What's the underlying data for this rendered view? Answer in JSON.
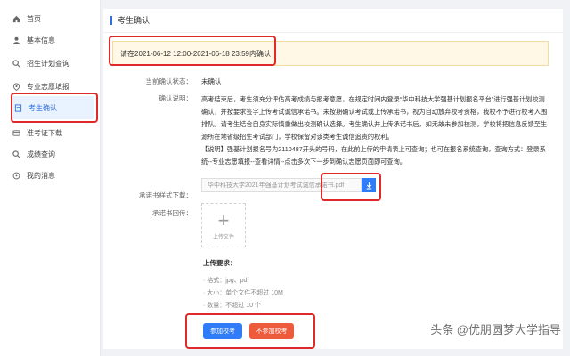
{
  "sidebar": {
    "items": [
      {
        "label": "首页",
        "icon": "home-icon"
      },
      {
        "label": "基本信息",
        "icon": "user-icon"
      },
      {
        "label": "招生计划查询",
        "icon": "search-icon"
      },
      {
        "label": "专业志愿填报",
        "icon": "location-icon"
      },
      {
        "label": "考生确认",
        "icon": "document-icon"
      },
      {
        "label": "准考证下载",
        "icon": "card-icon"
      },
      {
        "label": "成绩查询",
        "icon": "search-icon"
      },
      {
        "label": "我的消息",
        "icon": "message-icon"
      }
    ],
    "active_index": 4
  },
  "page": {
    "title": "考生确认",
    "notice": "请在2021-06-12 12:00-2021-06-18 23:59内确认",
    "status_label": "当前确认状态：",
    "status_value": "未确认",
    "desc_label": "确认说明：",
    "desc_paragraph1": "高考结束后，考生须充分评估高考成绩与报考意愿，在规定时间内登录“华中科技大学强基计划报名平台”进行强基计划校测确认，并按要求签字上传考试诚信承诺书。未按期确认考试或上传承诺书，视为自动放弃校考资格，我校不予进行校考入围排队。请考生结合自身实际慎重做出校测确认选择。考生确认并上传承诺书后，如无故未参加校测，学校将把信息反馈至生源所在地省级招生考试部门，学校保留对该类考生诚信追责的权利。",
    "desc_paragraph2": "【说明】强基计划报名号为2110487开头的号码，在此前上传的申请表上可查询；也可在报名系统查询，查询方式：登录系统--专业志愿填报--查看详情--点击多次下一步到确认志愿页面即可查询。",
    "template_label": "承诺书样式下载：",
    "template_file": "华中科技大学2021年强基计划考试诚信承诺书.pdf",
    "photo_label": "承诺书回传：",
    "upload_plus": "+",
    "upload_text": "上传文件",
    "req_title": "上传要求：",
    "req_items": [
      "格式：jpg、pdf",
      "大小：单个文件不超过 10M",
      "数量：不超过 10 个"
    ],
    "join_button": "参加校考",
    "not_join_button": "不参加校考"
  },
  "watermark": "头条 @优朋圆梦大学指导",
  "colors": {
    "accent": "#2f7cf6",
    "danger": "#ee5a3c",
    "highlight_box": "#e02a2a",
    "notice_bg": "#fff8e6"
  }
}
